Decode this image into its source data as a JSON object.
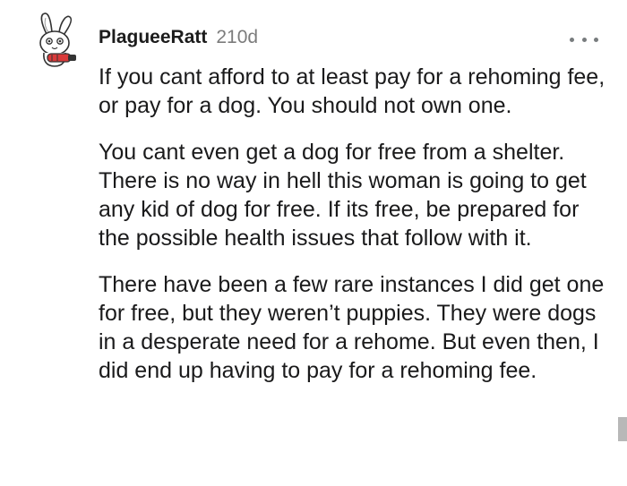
{
  "comment": {
    "username": "PlagueeRatt",
    "age": "210d",
    "more_icon": "ellipsis-icon",
    "avatar_icon": "bunny-avatar-icon",
    "paragraphs": [
      "If you cant afford to at least pay for a rehoming fee, or pay for a dog. You should not own one.",
      "You cant even get a dog for free from a shelter. There is no way in hell this woman is going to get any kid of dog for free. If its free, be prepared for the possible health issues that follow with it.",
      "There have been a few rare instances I did get one for free, but they weren’t puppies. They were dogs in a desperate need for a rehome. But even then, I did end up having to pay for a rehoming fee."
    ]
  },
  "colors": {
    "text": "#1a1a1b",
    "meta": "#7c7c7c",
    "avatar_accent": "#d93a3a"
  }
}
